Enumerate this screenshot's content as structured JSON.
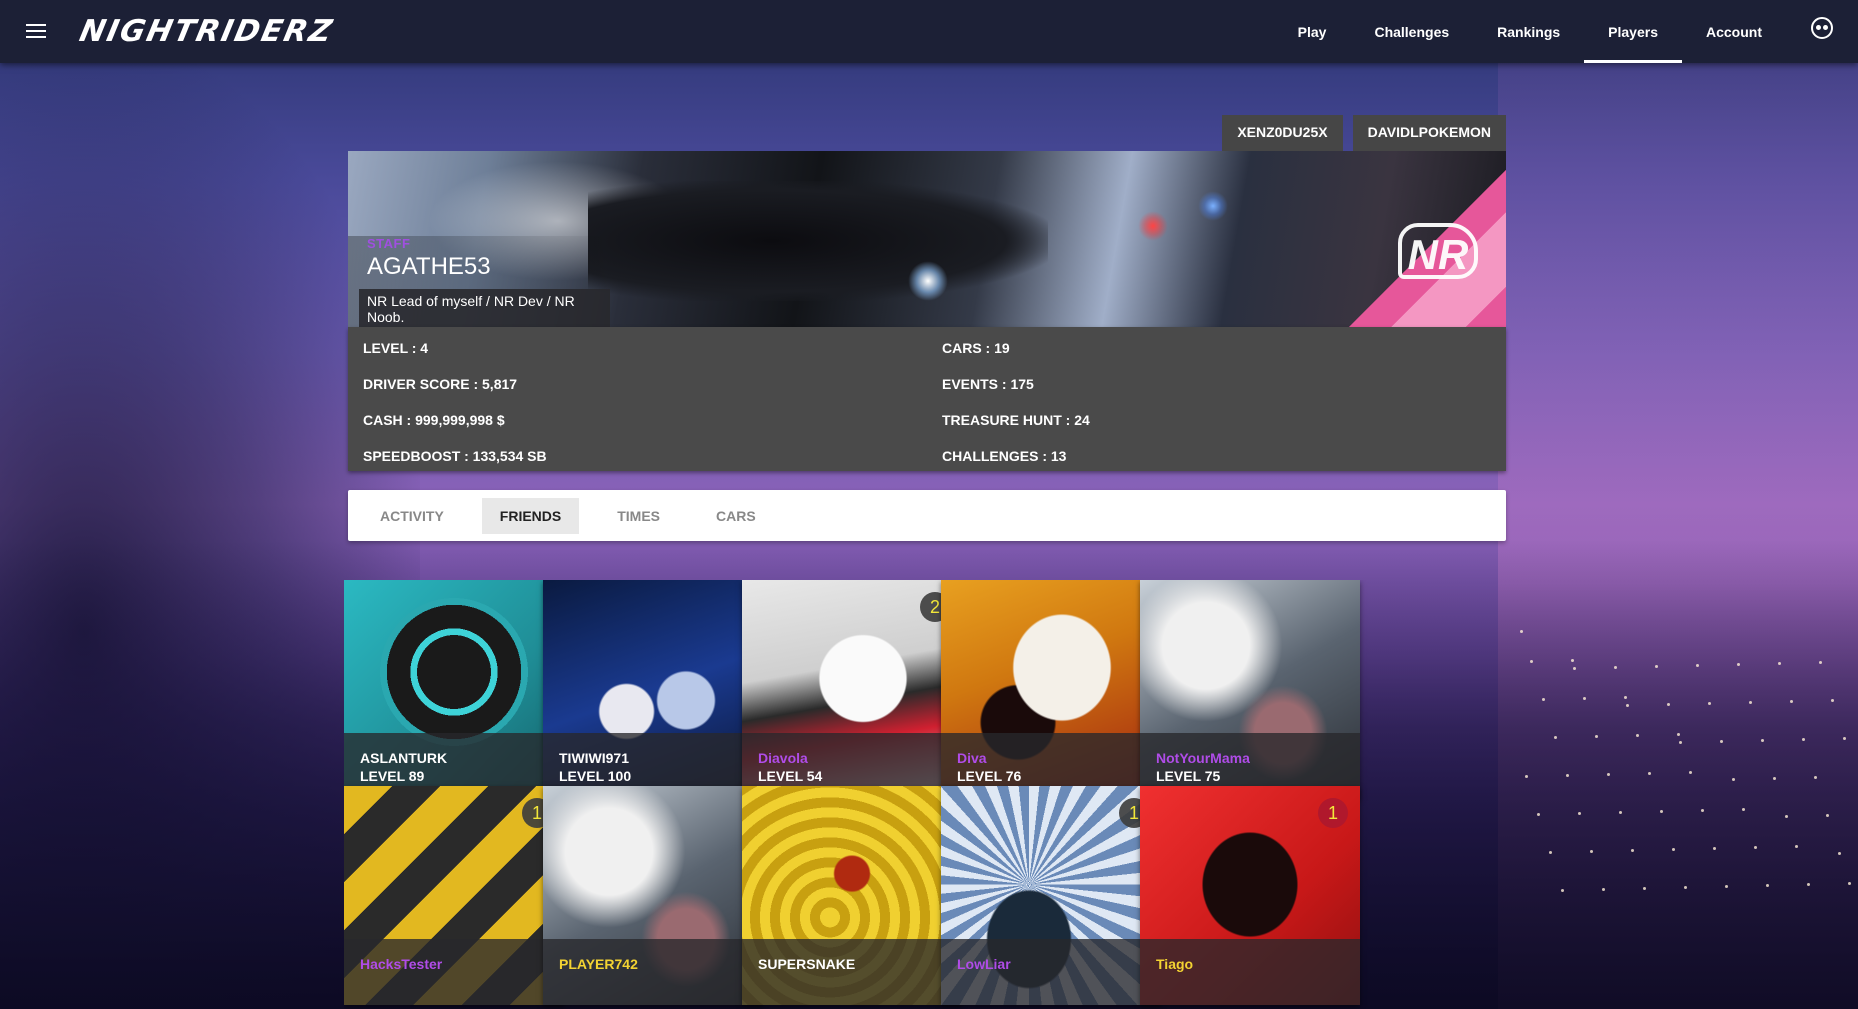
{
  "app": {
    "logo": "NIGHTRIDERZ",
    "nav": [
      {
        "label": "Play"
      },
      {
        "label": "Challenges"
      },
      {
        "label": "Rankings"
      },
      {
        "label": "Players"
      },
      {
        "label": "Account"
      }
    ],
    "active_nav": "Players"
  },
  "profile_switch": [
    "XENZ0DU25X",
    "DAVIDLPOKEMON"
  ],
  "player": {
    "tag": "STAFF",
    "name": "AGATHE53",
    "description": "NR Lead of myself / NR Dev / NR Noob."
  },
  "stats": {
    "left": [
      "LEVEL : 4",
      "DRIVER SCORE : 5,817",
      "CASH : 999,999,998 $",
      "SPEEDBOOST : 133,534 SB"
    ],
    "right": [
      "CARS : 19",
      "EVENTS : 175",
      "TREASURE HUNT : 24",
      "CHALLENGES : 13"
    ]
  },
  "tabs": [
    {
      "label": "ACTIVITY"
    },
    {
      "label": "FRIENDS"
    },
    {
      "label": "TIMES"
    },
    {
      "label": "CARS"
    }
  ],
  "active_tab": "FRIENDS",
  "friends": [
    {
      "name": "ASLANTURK",
      "level": "LEVEL 89",
      "name_color": "white",
      "badge": "",
      "art": "wheel"
    },
    {
      "name": "TIWIWI971",
      "level": "LEVEL 100",
      "name_color": "white",
      "badge": "",
      "art": "dice"
    },
    {
      "name": "Diavola",
      "level": "LEVEL 54",
      "name_color": "purple",
      "badge": "2",
      "art": "mask"
    },
    {
      "name": "Diva",
      "level": "LEVEL 76",
      "name_color": "purple",
      "badge": "",
      "art": "face"
    },
    {
      "name": "NotYourMama",
      "level": "LEVEL 75",
      "name_color": "purple",
      "badge": "",
      "art": "smoke"
    },
    {
      "name": "HacksTester",
      "level": "",
      "name_color": "purple",
      "badge": "1",
      "art": "stripes"
    },
    {
      "name": "PLAYER742",
      "level": "",
      "name_color": "yellow",
      "badge": "",
      "art": "smoke"
    },
    {
      "name": "SUPERSNAKE",
      "level": "",
      "name_color": "white",
      "badge": "",
      "art": "snake"
    },
    {
      "name": "LowLiar",
      "level": "",
      "name_color": "purple",
      "badge": "1",
      "art": "rays"
    },
    {
      "name": "Tiago",
      "level": "",
      "name_color": "yellow",
      "badge": "1",
      "art": "fist"
    }
  ],
  "colors": {
    "topbar": "#1c2036",
    "panel": "#4a4a4a",
    "staff": "#a04fe0",
    "purple_name": "#b04ce8",
    "yellow_name": "#f3d332"
  }
}
